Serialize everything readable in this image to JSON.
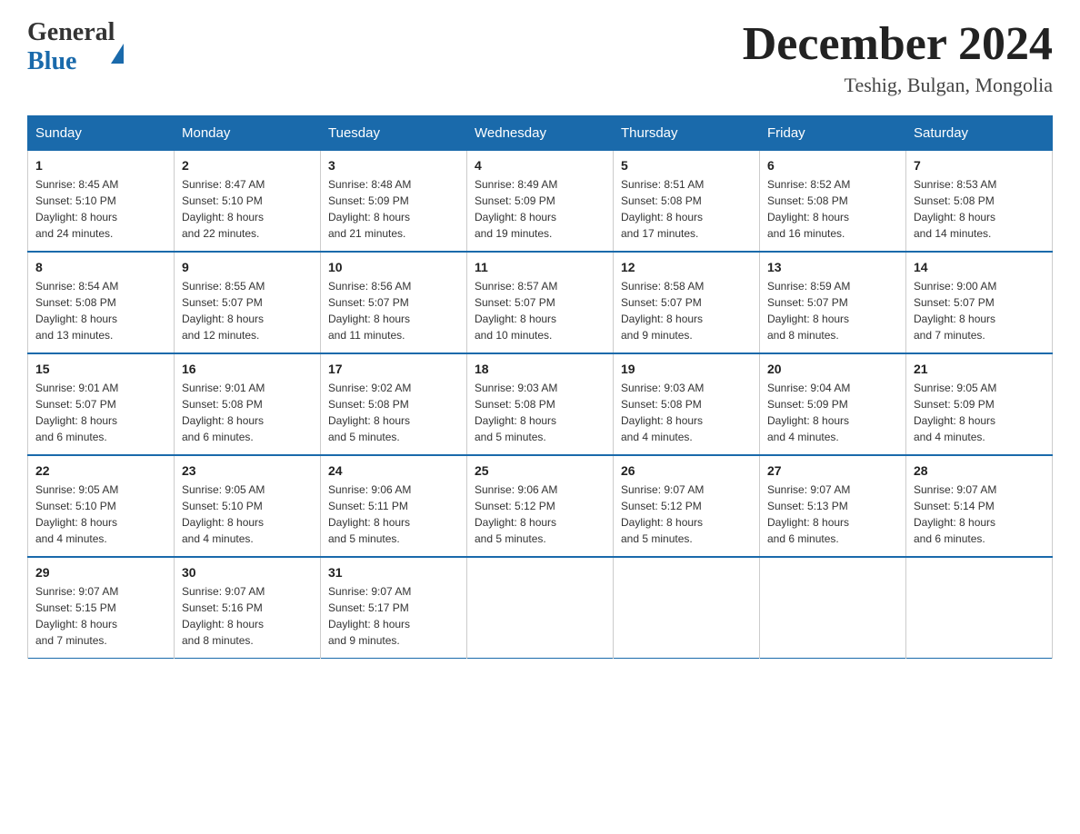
{
  "header": {
    "logo": {
      "general": "General",
      "blue": "Blue"
    },
    "month": "December 2024",
    "location": "Teshig, Bulgan, Mongolia"
  },
  "weekdays": [
    "Sunday",
    "Monday",
    "Tuesday",
    "Wednesday",
    "Thursday",
    "Friday",
    "Saturday"
  ],
  "weeks": [
    [
      {
        "day": "1",
        "sunrise": "8:45 AM",
        "sunset": "5:10 PM",
        "daylight": "8 hours and 24 minutes."
      },
      {
        "day": "2",
        "sunrise": "8:47 AM",
        "sunset": "5:10 PM",
        "daylight": "8 hours and 22 minutes."
      },
      {
        "day": "3",
        "sunrise": "8:48 AM",
        "sunset": "5:09 PM",
        "daylight": "8 hours and 21 minutes."
      },
      {
        "day": "4",
        "sunrise": "8:49 AM",
        "sunset": "5:09 PM",
        "daylight": "8 hours and 19 minutes."
      },
      {
        "day": "5",
        "sunrise": "8:51 AM",
        "sunset": "5:08 PM",
        "daylight": "8 hours and 17 minutes."
      },
      {
        "day": "6",
        "sunrise": "8:52 AM",
        "sunset": "5:08 PM",
        "daylight": "8 hours and 16 minutes."
      },
      {
        "day": "7",
        "sunrise": "8:53 AM",
        "sunset": "5:08 PM",
        "daylight": "8 hours and 14 minutes."
      }
    ],
    [
      {
        "day": "8",
        "sunrise": "8:54 AM",
        "sunset": "5:08 PM",
        "daylight": "8 hours and 13 minutes."
      },
      {
        "day": "9",
        "sunrise": "8:55 AM",
        "sunset": "5:07 PM",
        "daylight": "8 hours and 12 minutes."
      },
      {
        "day": "10",
        "sunrise": "8:56 AM",
        "sunset": "5:07 PM",
        "daylight": "8 hours and 11 minutes."
      },
      {
        "day": "11",
        "sunrise": "8:57 AM",
        "sunset": "5:07 PM",
        "daylight": "8 hours and 10 minutes."
      },
      {
        "day": "12",
        "sunrise": "8:58 AM",
        "sunset": "5:07 PM",
        "daylight": "8 hours and 9 minutes."
      },
      {
        "day": "13",
        "sunrise": "8:59 AM",
        "sunset": "5:07 PM",
        "daylight": "8 hours and 8 minutes."
      },
      {
        "day": "14",
        "sunrise": "9:00 AM",
        "sunset": "5:07 PM",
        "daylight": "8 hours and 7 minutes."
      }
    ],
    [
      {
        "day": "15",
        "sunrise": "9:01 AM",
        "sunset": "5:07 PM",
        "daylight": "8 hours and 6 minutes."
      },
      {
        "day": "16",
        "sunrise": "9:01 AM",
        "sunset": "5:08 PM",
        "daylight": "8 hours and 6 minutes."
      },
      {
        "day": "17",
        "sunrise": "9:02 AM",
        "sunset": "5:08 PM",
        "daylight": "8 hours and 5 minutes."
      },
      {
        "day": "18",
        "sunrise": "9:03 AM",
        "sunset": "5:08 PM",
        "daylight": "8 hours and 5 minutes."
      },
      {
        "day": "19",
        "sunrise": "9:03 AM",
        "sunset": "5:08 PM",
        "daylight": "8 hours and 4 minutes."
      },
      {
        "day": "20",
        "sunrise": "9:04 AM",
        "sunset": "5:09 PM",
        "daylight": "8 hours and 4 minutes."
      },
      {
        "day": "21",
        "sunrise": "9:05 AM",
        "sunset": "5:09 PM",
        "daylight": "8 hours and 4 minutes."
      }
    ],
    [
      {
        "day": "22",
        "sunrise": "9:05 AM",
        "sunset": "5:10 PM",
        "daylight": "8 hours and 4 minutes."
      },
      {
        "day": "23",
        "sunrise": "9:05 AM",
        "sunset": "5:10 PM",
        "daylight": "8 hours and 4 minutes."
      },
      {
        "day": "24",
        "sunrise": "9:06 AM",
        "sunset": "5:11 PM",
        "daylight": "8 hours and 5 minutes."
      },
      {
        "day": "25",
        "sunrise": "9:06 AM",
        "sunset": "5:12 PM",
        "daylight": "8 hours and 5 minutes."
      },
      {
        "day": "26",
        "sunrise": "9:07 AM",
        "sunset": "5:12 PM",
        "daylight": "8 hours and 5 minutes."
      },
      {
        "day": "27",
        "sunrise": "9:07 AM",
        "sunset": "5:13 PM",
        "daylight": "8 hours and 6 minutes."
      },
      {
        "day": "28",
        "sunrise": "9:07 AM",
        "sunset": "5:14 PM",
        "daylight": "8 hours and 6 minutes."
      }
    ],
    [
      {
        "day": "29",
        "sunrise": "9:07 AM",
        "sunset": "5:15 PM",
        "daylight": "8 hours and 7 minutes."
      },
      {
        "day": "30",
        "sunrise": "9:07 AM",
        "sunset": "5:16 PM",
        "daylight": "8 hours and 8 minutes."
      },
      {
        "day": "31",
        "sunrise": "9:07 AM",
        "sunset": "5:17 PM",
        "daylight": "8 hours and 9 minutes."
      },
      null,
      null,
      null,
      null
    ]
  ],
  "labels": {
    "sunrise": "Sunrise:",
    "sunset": "Sunset:",
    "daylight": "Daylight:"
  }
}
